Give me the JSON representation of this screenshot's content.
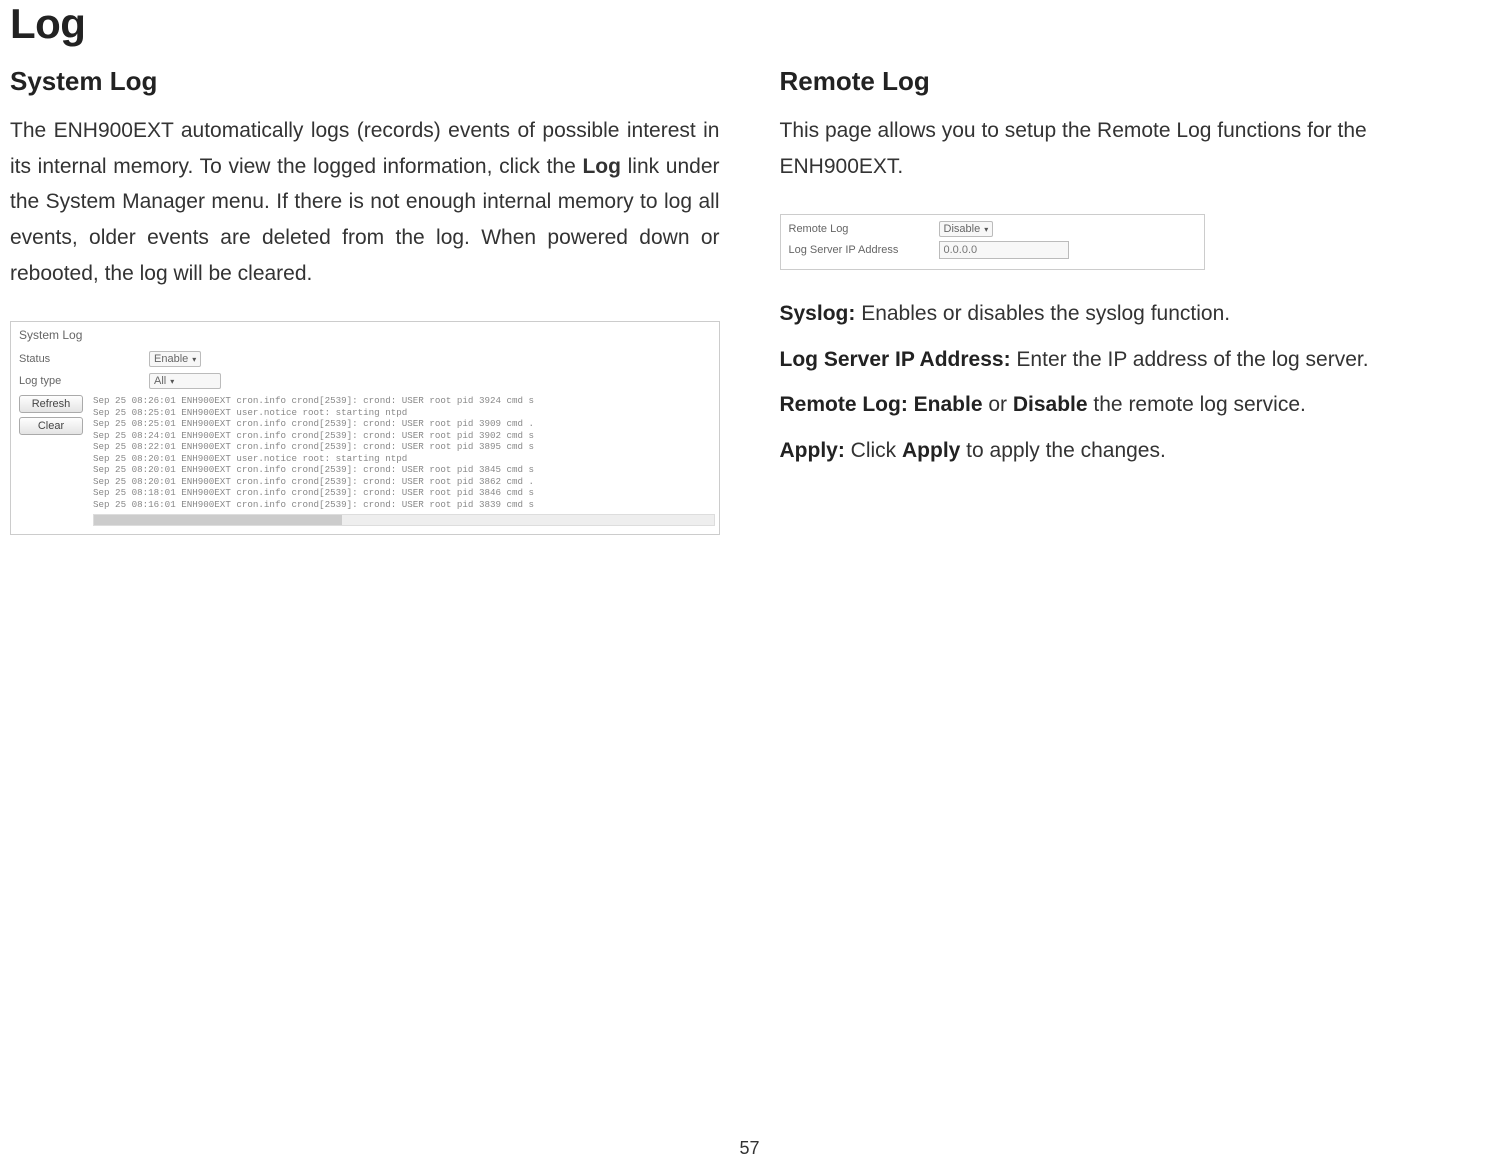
{
  "page": {
    "title": "Log",
    "number": "57"
  },
  "left": {
    "heading": "System Log",
    "para_before_bold": "The ENH900EXT automatically logs (records) events of possible interest in its internal memory. To view the logged information, click the ",
    "para_bold": "Log",
    "para_after_bold": " link under the System Manager menu. If there is not enough internal memory to log all events, older events are deleted from the log. When powered down or rebooted, the log will be cleared.",
    "panel": {
      "title": "System Log",
      "status_label": "Status",
      "status_value": "Enable",
      "logtype_label": "Log type",
      "logtype_value": "All",
      "refresh_btn": "Refresh",
      "clear_btn": "Clear",
      "lines": [
        "Sep 25 08:26:01 ENH900EXT cron.info crond[2539]: crond: USER root pid 3924 cmd s",
        "Sep 25 08:25:01 ENH900EXT user.notice root: starting ntpd",
        "Sep 25 08:25:01 ENH900EXT cron.info crond[2539]: crond: USER root pid 3909 cmd .",
        "Sep 25 08:24:01 ENH900EXT cron.info crond[2539]: crond: USER root pid 3902 cmd s",
        "Sep 25 08:22:01 ENH900EXT cron.info crond[2539]: crond: USER root pid 3895 cmd s",
        "Sep 25 08:20:01 ENH900EXT user.notice root: starting ntpd",
        "Sep 25 08:20:01 ENH900EXT cron.info crond[2539]: crond: USER root pid 3845 cmd s",
        "Sep 25 08:20:01 ENH900EXT cron.info crond[2539]: crond: USER root pid 3862 cmd .",
        "Sep 25 08:18:01 ENH900EXT cron.info crond[2539]: crond: USER root pid 3846 cmd s",
        "Sep 25 08:16:01 ENH900EXT cron.info crond[2539]: crond: USER root pid 3839 cmd s"
      ]
    }
  },
  "right": {
    "heading": "Remote Log",
    "para": "This page allows you to setup the Remote Log functions for the ENH900EXT.",
    "panel": {
      "remote_label": "Remote Log",
      "remote_value": "Disable",
      "ip_label": "Log Server IP Address",
      "ip_placeholder": "0.0.0.0"
    },
    "defs": {
      "syslog_bold": "Syslog:",
      "syslog_text": " Enables or disables the syslog function.",
      "logip_bold": "Log Server IP Address:",
      "logip_text": " Enter the IP address of the log server.",
      "remote_bold": "Remote Log:",
      "remote_mid1": " ",
      "remote_enable": "Enable",
      "remote_or": " or ",
      "remote_disable": "Disable",
      "remote_rest": " the remote log service.",
      "apply_bold": "Apply:",
      "apply_mid": " Click ",
      "apply_word": "Apply",
      "apply_rest": " to apply the changes."
    }
  }
}
